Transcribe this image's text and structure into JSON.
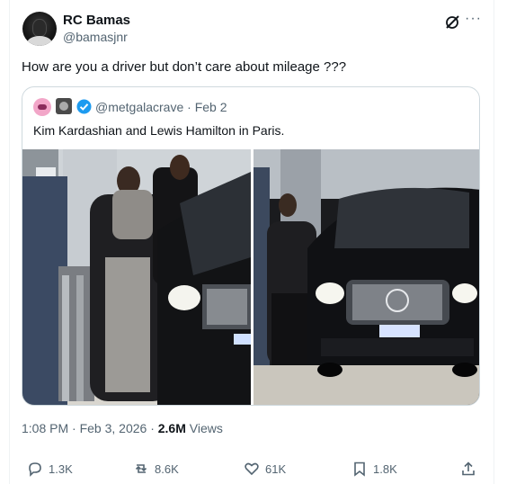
{
  "post": {
    "author_name": "RC Bamas",
    "author_handle": "@bamasjnr",
    "text": "How are you a driver but don’t care about mileage ???"
  },
  "quoted_post": {
    "handle_and_date": "@metgalacrave · Feb 2",
    "text": "Kim Kardashian and Lewis Hamilton in Paris.",
    "verified": true,
    "verified_color": "#1d9bf0"
  },
  "meta": {
    "timestamp": "1:08 PM · Feb 3, 2026 · ",
    "views_count": "2.6M",
    "views_label": " Views"
  },
  "actions": {
    "replies": "1.3K",
    "reposts": "8.6K",
    "likes": "61K",
    "bookmarks": "1.8K"
  },
  "icons": [
    "grok-icon",
    "more-icon",
    "verified-icon",
    "reply-icon",
    "repost-icon",
    "like-icon",
    "bookmark-icon",
    "share-icon"
  ],
  "colors": {
    "text": "#0f1419",
    "secondary": "#536471",
    "border": "#cfd9de",
    "accent": "#1d9bf0"
  }
}
